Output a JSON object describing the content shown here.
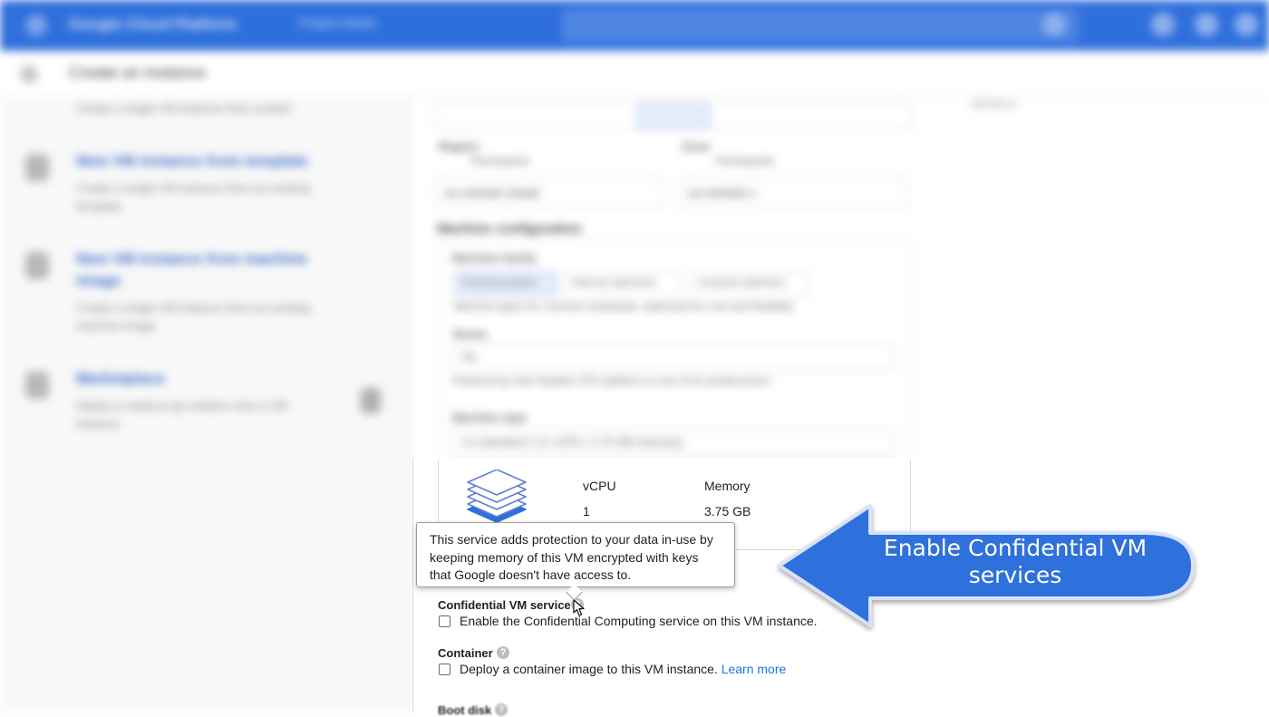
{
  "topbar": {
    "brand": "Google Cloud Platform",
    "project": "Project Name"
  },
  "subbar": {
    "title": "Create an instance"
  },
  "left_panel": {
    "top_text": "Create a single VM instance from scratch",
    "options": [
      {
        "title": "New VM instance from template",
        "desc": "Create a single VM instance from an existing template"
      },
      {
        "title": "New VM instance from machine image",
        "desc": "Create a single VM instance from an existing machine image"
      },
      {
        "title": "Marketplace",
        "desc": "Deploy a ready-to-go solution onto a VM instance"
      }
    ]
  },
  "right_panel": {
    "region_label": "Region",
    "region_value": "us-central1 (Iowa)",
    "zone_label": "Zone",
    "zone_value": "us-central1-c",
    "region_hint": "Permanent",
    "zone_hint": "Permanent",
    "machine_config": "Machine configuration",
    "machine_family": "Machine family",
    "family_tabs": [
      "General-purpose",
      "Memory-optimized",
      "Compute-optimized"
    ],
    "family_desc": "Machine types for common workloads, optimized for cost and flexibility",
    "series_label": "Series",
    "series_value": "N1",
    "series_desc": "Powered by Intel Skylake CPU platform or one of its predecessors",
    "machine_type_label": "Machine type",
    "machine_type_value": "n1-standard-1 (1 vCPU, 3.75 GB memory)",
    "side_link": "DETAILS"
  },
  "machine_card": {
    "vcpu_label": "vCPU",
    "vcpu_value": "1",
    "memory_label": "Memory",
    "memory_value": "3.75 GB"
  },
  "tooltip": {
    "line1": "This service adds protection to your data in-use by",
    "line2": "keeping memory of this VM encrypted with keys",
    "line3": "that Google doesn't have access to."
  },
  "confidential": {
    "label": "Confidential VM service",
    "checkbox_text": "Enable the Confidential Computing service on this VM instance.",
    "checked": false
  },
  "container": {
    "label": "Container",
    "checkbox_text": "Deploy a container image to this VM instance.",
    "learn_more": "Learn more",
    "checked": false
  },
  "boot_disk": {
    "label": "Boot disk"
  },
  "callout": {
    "line1": "Enable Confidential VM",
    "line2": "services",
    "color": "#2f6fdc"
  }
}
